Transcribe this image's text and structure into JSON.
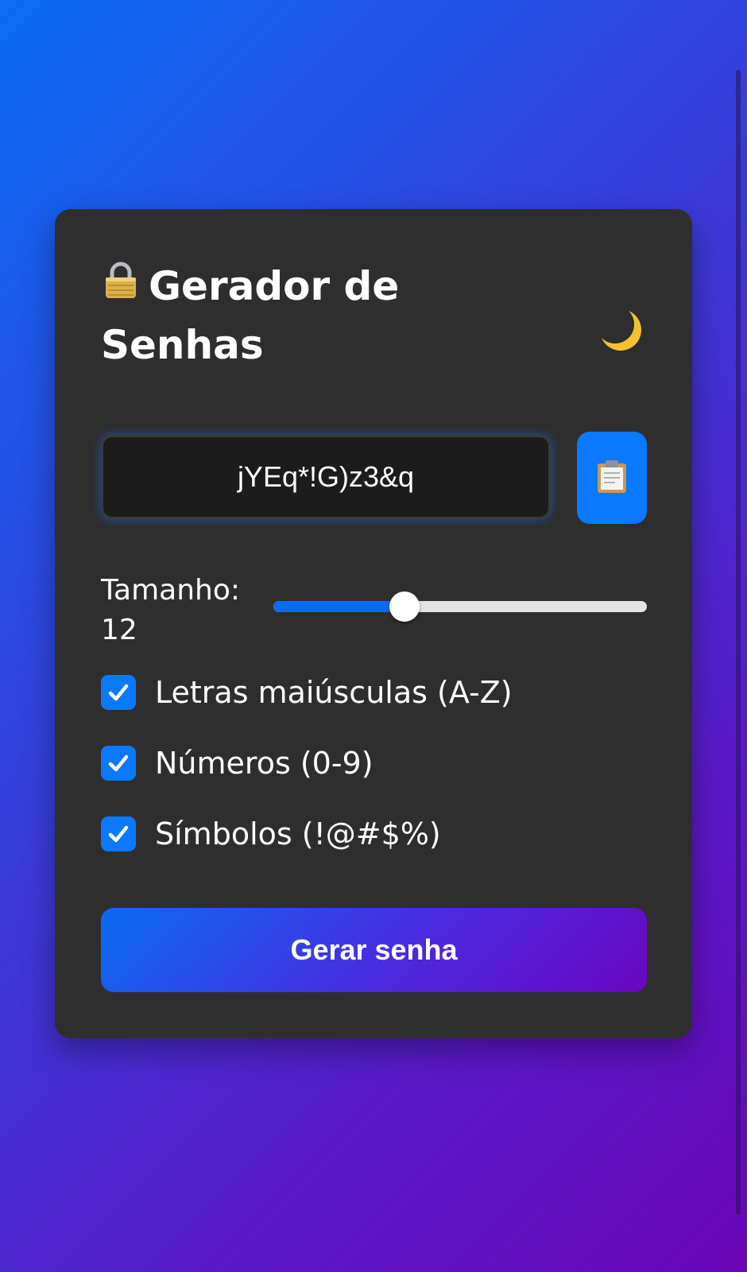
{
  "app": {
    "title": "Gerador de Senhas",
    "title_icon": "lock-icon",
    "theme_toggle_icon": "moon-icon"
  },
  "password": {
    "value": "jYEq*!G)z3&q",
    "copy_icon": "clipboard-icon"
  },
  "length": {
    "label": "Tamanho:",
    "value": "12",
    "slider_fraction": 0.35
  },
  "options": [
    {
      "label": "Letras maiúsculas (A-Z)",
      "checked": true
    },
    {
      "label": "Números (0-9)",
      "checked": true
    },
    {
      "label": "Símbolos (!@#$%)",
      "checked": true
    }
  ],
  "generate_button": {
    "label": "Gerar senha"
  },
  "colors": {
    "accent": "#0a78ff",
    "card_background": "#2e2e2e",
    "input_background": "#1c1c1c",
    "gradient_start": "#0a6cf5",
    "gradient_end": "#6a06b8"
  }
}
